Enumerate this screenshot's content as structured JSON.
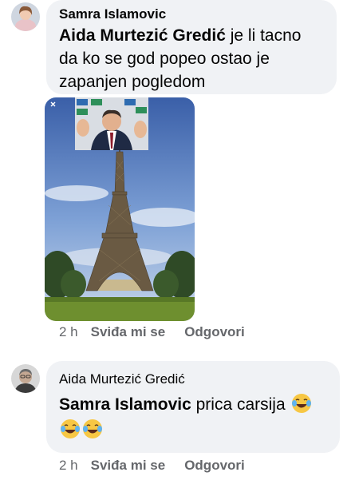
{
  "comment": {
    "author": "Samra Islamovic",
    "mention": "Aida Murtezić Gredić",
    "text_line1": " je li tacno",
    "text_line2": "da ko se god popeo ostao je",
    "text_line3": "zapanjen pogledom",
    "image_icon": "eiffel-tower-photo-with-man-overlay",
    "timestamp": "2 h",
    "like_label": "Sviđa mi se",
    "reply_label": "Odgovori"
  },
  "reply": {
    "author": "Aida Murtezić Gredić",
    "mention": "Samra Islamovic",
    "text": "prica carsija",
    "emoji_icon": "face-with-tears-of-joy-icon",
    "timestamp": "2 h",
    "like_label": "Sviđa mi se",
    "reply_label": "Odgovori"
  },
  "colors": {
    "bubble_bg": "#f0f2f5",
    "meta_text": "#65676b",
    "body_text": "#050505"
  }
}
